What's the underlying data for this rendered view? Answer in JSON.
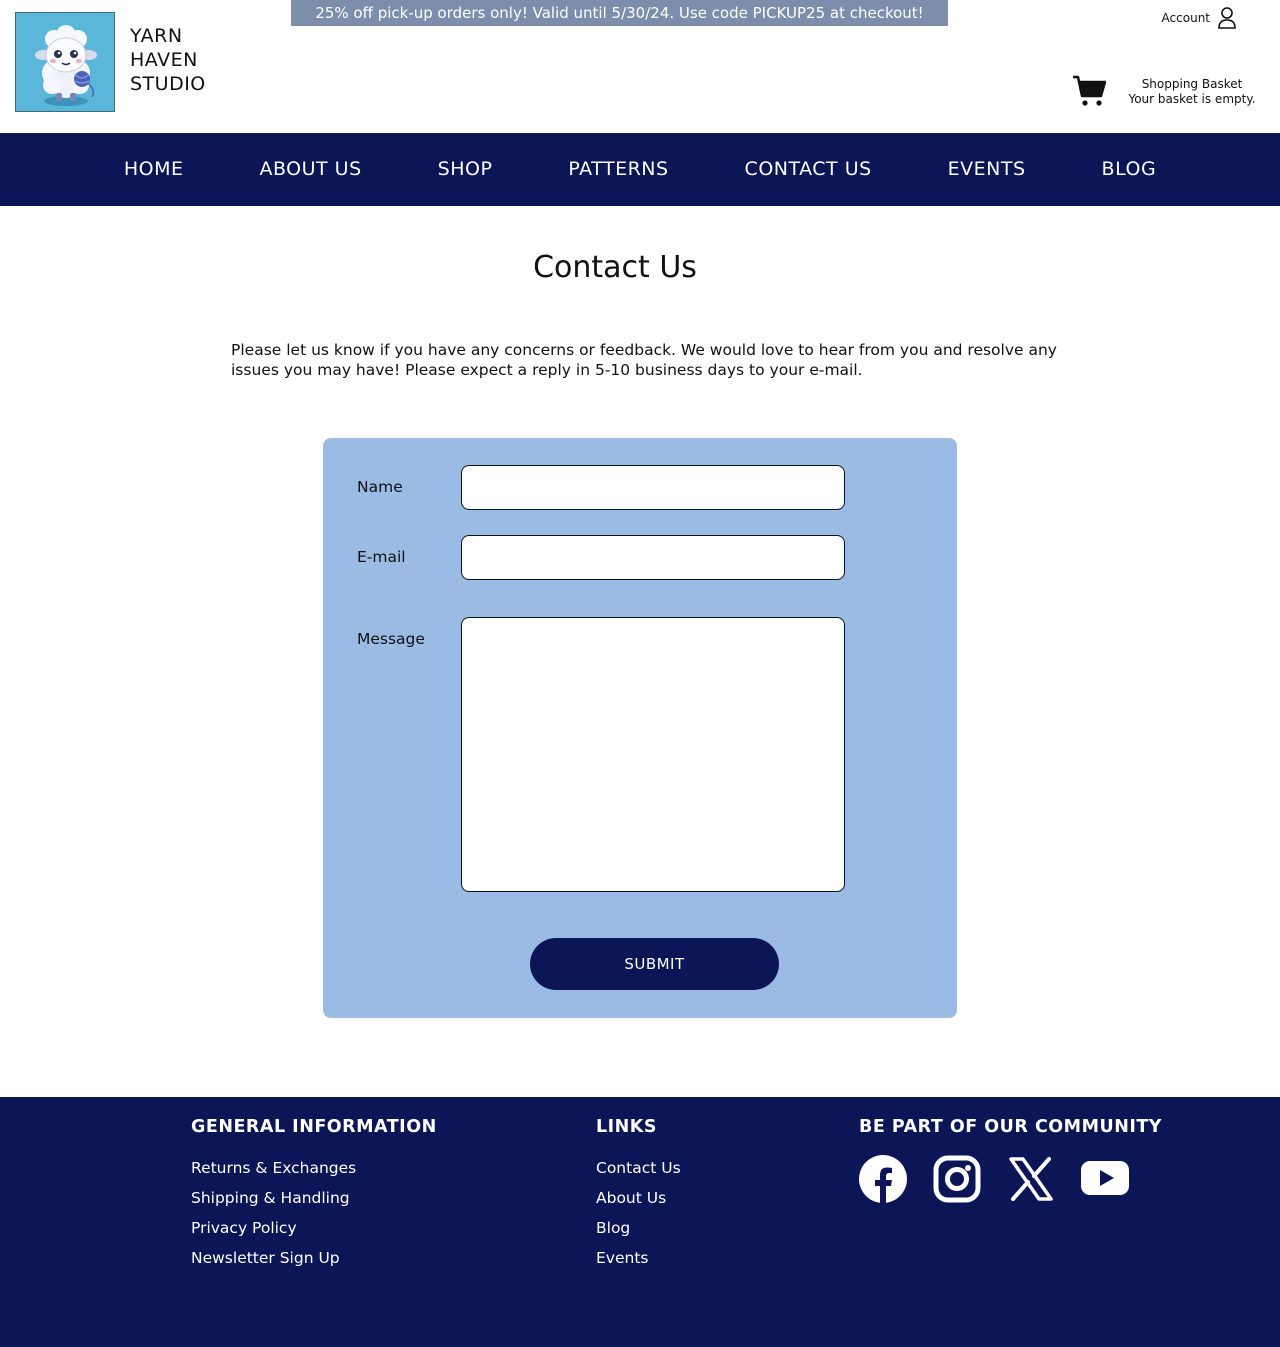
{
  "brand": {
    "lines": [
      "YARN",
      "HAVEN",
      "STUDIO"
    ],
    "logo_icon": "sheep-mascot-icon"
  },
  "promo": {
    "text": "25% off pick-up orders only! Valid until 5/30/24. Use code PICKUP25 at checkout!"
  },
  "account": {
    "label": "Account",
    "icon": "user-icon"
  },
  "basket": {
    "title": "Shopping Basket",
    "status": "Your basket is empty.",
    "icon": "shopping-cart-icon"
  },
  "nav": {
    "items": [
      "HOME",
      "ABOUT US",
      "SHOP",
      "PATTERNS",
      "CONTACT US",
      "EVENTS",
      "BLOG"
    ]
  },
  "main": {
    "title": "Contact Us",
    "intro": "Please let us know if you have any concerns or feedback. We would love to hear from you and resolve any issues you may have! Please expect a reply in 5-10 business days to your e-mail."
  },
  "form": {
    "name_label": "Name",
    "name_value": "",
    "email_label": "E-mail",
    "email_value": "",
    "message_label": "Message",
    "message_value": "",
    "submit_label": "SUBMIT"
  },
  "footer": {
    "general": {
      "heading": "GENERAL INFORMATION",
      "links": [
        "Returns & Exchanges",
        "Shipping & Handling",
        "Privacy Policy",
        "Newsletter Sign Up"
      ]
    },
    "links": {
      "heading": "LINKS",
      "links": [
        "Contact Us",
        "About Us",
        "Blog",
        "Events"
      ]
    },
    "community": {
      "heading": "BE PART OF OUR COMMUNITY",
      "icons": [
        "facebook-icon",
        "instagram-icon",
        "x-twitter-icon",
        "youtube-icon"
      ]
    }
  },
  "colors": {
    "navy": "#0c1657",
    "form_bg": "#9abbe3",
    "promo_bg": "#7c8eac",
    "logo_bg": "#5bb7d9"
  }
}
